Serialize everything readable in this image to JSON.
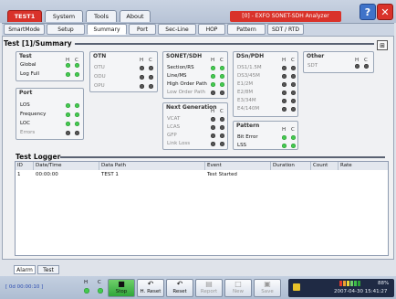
{
  "top_tabs": [
    "TEST1",
    "System",
    "Tools",
    "About"
  ],
  "app_title": "[0] - EXFO SONET-SDH Analyzer",
  "window_buttons": {
    "help": "?",
    "close": "✕"
  },
  "sub_tabs": [
    "SmartMode",
    "Setup",
    "Summary",
    "Port",
    "Sec-Line",
    "HOP",
    "Pattern",
    "SDT / RTD"
  ],
  "summary_title": "Test [1]/Summary",
  "hc": {
    "h": "H",
    "c": "C"
  },
  "groups": {
    "test": {
      "title": "Test",
      "rows": [
        "Global",
        "Log Full"
      ]
    },
    "port": {
      "title": "Port",
      "rows": [
        "LOS",
        "Frequency",
        "LOC",
        "Errors"
      ]
    },
    "otn": {
      "title": "OTN",
      "rows": [
        "OTU",
        "ODU",
        "OPU"
      ]
    },
    "sonet": {
      "title": "SONET/SDH",
      "rows": [
        "Section/RS",
        "Line/MS",
        "High Order Path",
        "Low Order Path"
      ]
    },
    "next_gen": {
      "title": "Next Generation",
      "rows": [
        "VCAT",
        "LCAS",
        "GFP",
        "Link Loss"
      ]
    },
    "dsn": {
      "title": "DSn/PDH",
      "rows": [
        "DS1/1.5M",
        "DS3/45M",
        "E1/2M",
        "E2/8M",
        "E3/34M",
        "E4/140M"
      ]
    },
    "pattern": {
      "title": "Pattern",
      "rows": [
        "Bit Error",
        "LSS"
      ]
    },
    "other": {
      "title": "Other",
      "rows": [
        "SDT"
      ]
    }
  },
  "logger": {
    "title": "Test Logger",
    "columns": [
      "ID",
      "Date/Time",
      "Data Path",
      "Event",
      "Duration",
      "Count",
      "Rate"
    ],
    "rows": [
      {
        "id": "1",
        "datetime": "00:00:00",
        "data_path": "TEST 1",
        "event": "Test Started",
        "duration": "",
        "count": "",
        "rate": ""
      }
    ]
  },
  "bottom_tabs": [
    "Alarm",
    "Test"
  ],
  "status": {
    "time": "[ 0d 00:00:10 ]",
    "buttons": {
      "stop": "Stop",
      "h_reset": "H. Reset",
      "reset": "Reset",
      "report": "Report",
      "new": "New",
      "save": "Save"
    },
    "battery": "88%",
    "clock": "2007-04-30 15:41:27"
  },
  "colors": {
    "accent": "#d9322a",
    "led_green": "#43c94f",
    "led_off": "#555555"
  }
}
